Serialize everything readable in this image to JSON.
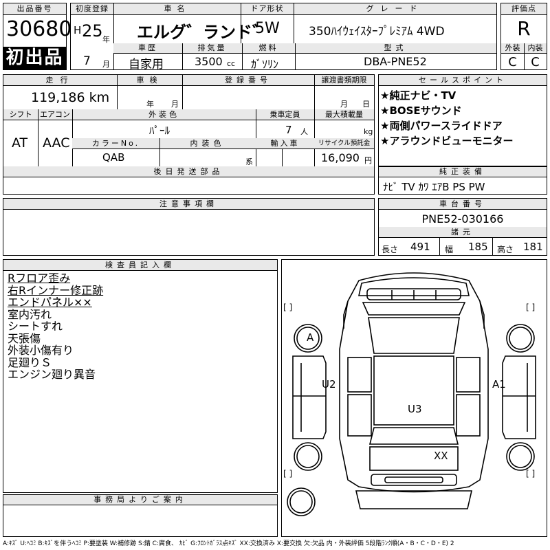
{
  "header": {
    "lot_label": "出品番号",
    "lot_number": "30680",
    "first_listing": "初出品",
    "first_reg_label": "初度登録",
    "era": "H",
    "year": "25",
    "year_unit": "年",
    "month": "7",
    "month_unit": "月",
    "model_label": "車名",
    "model": "エルグ゛ランド゛",
    "door_label": "ドア形状",
    "door": "5W",
    "grade_label": "グレード",
    "grade": "350ﾊｲｳｪｲｽﾀｰﾌﾟﾚﾐｱﾑ 4WD",
    "rating_label": "評価点",
    "rating": "R",
    "history_label": "車歴",
    "history": "自家用",
    "displacement_label": "排気量",
    "displacement": "3500",
    "displacement_unit": "cc",
    "fuel_label": "燃料",
    "fuel": "ｶﾞｿﾘﾝ",
    "type_label": "型式",
    "type": "DBA-PNE52",
    "exterior_label": "外装",
    "exterior_grade": "C",
    "interior_label": "内装",
    "interior_grade": "C"
  },
  "row2": {
    "mileage_label": "走行",
    "mileage": "119,186 km",
    "inspection_label": "車検",
    "inspection_year": "年",
    "inspection_month": "月",
    "plate_label": "登録番号",
    "transfer_label": "譲渡書類期限",
    "transfer_month": "月",
    "transfer_day": "日",
    "shift_label": "シフト",
    "shift": "AT",
    "ac_label": "エアコン",
    "ac": "AAC",
    "color_label": "外装色",
    "color": "ﾊﾟｰﾙ",
    "capacity_label": "乗車定員",
    "capacity": "7",
    "capacity_unit": "人",
    "load_label": "最大積載量",
    "load_unit": "kg",
    "color_no_label": "カラーNo.",
    "color_no": "QAB",
    "interior_color_label": "内装色",
    "interior_color_unit": "系",
    "import_label": "輸入車",
    "recycle_label": "リサイクル預託金",
    "recycle": "16,090",
    "recycle_unit": "円",
    "later_parts_label": "後日発送部品"
  },
  "sales": {
    "label": "セールスポイント",
    "points": [
      "★純正ナビ・TV",
      "★BOSEサウンド",
      "★両側パワースライドドア",
      "★アラウンドビューモニター"
    ]
  },
  "equipment": {
    "label": "純正装備",
    "value": "ﾅﾋﾞ TV ｶﾜ ｴｱB PS PW"
  },
  "notes": {
    "label": "注意事項欄"
  },
  "chassis": {
    "label": "車台番号",
    "value": "PNE52-030166",
    "dims_label": "諸元",
    "length_label": "長さ",
    "length": "491",
    "width_label": "幅",
    "width": "185",
    "height_label": "高さ",
    "height": "181"
  },
  "inspector": {
    "label": "検査員記入欄",
    "lines": [
      {
        "text": "Rフロア歪み",
        "underline": true
      },
      {
        "text": "右Rインナー修正跡",
        "underline": true
      },
      {
        "text": "エンドパネル××",
        "underline": true
      },
      {
        "text": "室内汚れ",
        "underline": false
      },
      {
        "text": "シートすれ",
        "underline": false
      },
      {
        "text": "天張傷",
        "underline": false
      },
      {
        "text": "外装小傷有り",
        "underline": false
      },
      {
        "text": "足廻りＳ",
        "underline": false
      },
      {
        "text": "エンジン廻り異音",
        "underline": false
      }
    ]
  },
  "office": {
    "label": "事務局よりご案内"
  },
  "diagram": {
    "marks": [
      "A",
      "U2",
      "A1",
      "U3",
      "XX"
    ],
    "bracket": "[   ]"
  },
  "legend": "A:ｷｽﾞ U:ﾍｺﾐ B:ｷｽﾞを伴うﾍｺﾐ P:要塗装 W:補修跡 S:錆 C:腐食、 ｶﾋﾞ G:ﾌﾛﾝﾄｶﾞﾗｽ点ｷｽﾞ XX:交換済み X:要交換 欠:欠品 内・外装評価 5段階ﾗﾝｸ順(A・B・C・D・E) 2"
}
